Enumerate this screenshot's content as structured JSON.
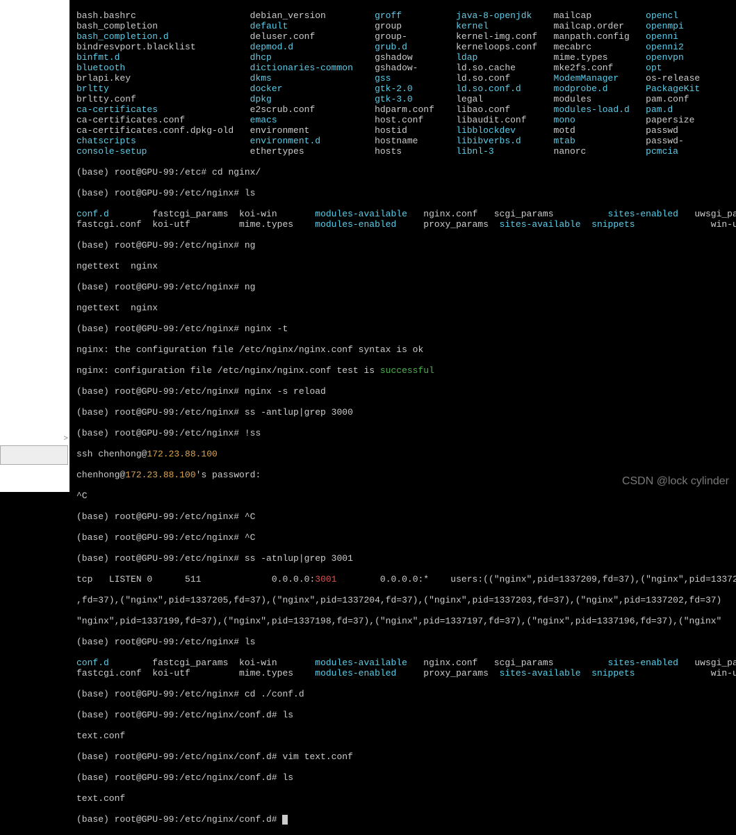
{
  "etc_ls": {
    "col1": [
      "bash.bashrc",
      "bash_completion",
      "bash_completion.d",
      "bindresvport.blacklist",
      "binfmt.d",
      "bluetooth",
      "brlapi.key",
      "brltty",
      "brltty.conf",
      "ca-certificates",
      "ca-certificates.conf",
      "ca-certificates.conf.dpkg-old",
      "chatscripts",
      "console-setup"
    ],
    "col1_class": [
      "w",
      "w",
      "c",
      "w",
      "c",
      "c",
      "w",
      "c",
      "w",
      "c",
      "w",
      "w",
      "c",
      "c"
    ],
    "col2": [
      "debian_version",
      "default",
      "deluser.conf",
      "depmod.d",
      "dhcp",
      "dictionaries-common",
      "dkms",
      "docker",
      "dpkg",
      "e2scrub.conf",
      "emacs",
      "environment",
      "environment.d",
      "ethertypes"
    ],
    "col2_class": [
      "w",
      "c",
      "w",
      "c",
      "c",
      "c",
      "c",
      "c",
      "c",
      "w",
      "c",
      "w",
      "c",
      "w"
    ],
    "col3": [
      "groff",
      "group",
      "group-",
      "grub.d",
      "gshadow",
      "gshadow-",
      "gss",
      "gtk-2.0",
      "gtk-3.0",
      "hdparm.conf",
      "host.conf",
      "hostid",
      "hostname",
      "hosts"
    ],
    "col3_class": [
      "c",
      "w",
      "w",
      "c",
      "w",
      "w",
      "c",
      "c",
      "c",
      "w",
      "w",
      "w",
      "w",
      "w"
    ],
    "col4": [
      "java-8-openjdk",
      "kernel",
      "kernel-img.conf",
      "kerneloops.conf",
      "ldap",
      "ld.so.cache",
      "ld.so.conf",
      "ld.so.conf.d",
      "legal",
      "libao.conf",
      "libaudit.conf",
      "libblockdev",
      "libibverbs.d",
      "libnl-3"
    ],
    "col4_class": [
      "c",
      "c",
      "w",
      "w",
      "c",
      "w",
      "w",
      "c",
      "w",
      "w",
      "w",
      "c",
      "c",
      "c"
    ],
    "col5": [
      "mailcap",
      "mailcap.order",
      "manpath.config",
      "mecabrc",
      "mime.types",
      "mke2fs.conf",
      "ModemManager",
      "modprobe.d",
      "modules",
      "modules-load.d",
      "mono",
      "motd",
      "mtab",
      "nanorc"
    ],
    "col5_class": [
      "w",
      "w",
      "w",
      "w",
      "w",
      "w",
      "c",
      "c",
      "w",
      "c",
      "c",
      "w",
      "c",
      "w"
    ],
    "col6": [
      "opencl",
      "openmpi",
      "openni",
      "openni2",
      "openvpn",
      "opt",
      "os-release",
      "PackageKit",
      "pam.conf",
      "pam.d",
      "papersize",
      "passwd",
      "passwd-",
      "pcmcia"
    ],
    "col6_class": [
      "c",
      "c",
      "c",
      "c",
      "c",
      "c",
      "w",
      "c",
      "w",
      "c",
      "w",
      "w",
      "w",
      "c"
    ]
  },
  "prompt_etc": "(base) root@GPU-99:/etc# ",
  "prompt_nginx": "(base) root@GPU-99:/etc/nginx# ",
  "prompt_confd": "(base) root@GPU-99:/etc/nginx/conf.d# ",
  "cmds": {
    "cd_nginx": "cd nginx/",
    "ls": "ls",
    "ng": "ng",
    "ngettext_nginx": "ngettext  nginx",
    "nginx_t": "nginx -t",
    "t_line1": "nginx: the configuration file /etc/nginx/nginx.conf syntax is ok",
    "t_line2_a": "nginx: configuration file /etc/nginx/nginx.conf test is ",
    "t_line2_b": "successful",
    "reload": "nginx -s reload",
    "ss1": "ss -antlup|grep 3000",
    "bang_ss": "!ss",
    "ssh_a": "ssh chenhong@",
    "ssh_ip": "172.23.88.100",
    "pw_a": "chenhong@",
    "pw_b": "172.23.88.100",
    "pw_c": "'s password:",
    "ctrlc": "^C",
    "ss2": "ss -atnlup|grep 3001",
    "tcp_a": "tcp   LISTEN 0      511             0.0.0.0:",
    "tcp_port": "3001",
    "tcp_b": "        0.0.0.0:*    users:((\"nginx\",pid=1337209,fd=37),(\"nginx\",pid=13372",
    "tcp_l2": ",fd=37),(\"nginx\",pid=1337205,fd=37),(\"nginx\",pid=1337204,fd=37),(\"nginx\",pid=1337203,fd=37),(\"nginx\",pid=1337202,fd=37)",
    "tcp_l3": "\"nginx\",pid=1337199,fd=37),(\"nginx\",pid=1337198,fd=37),(\"nginx\",pid=1337197,fd=37),(\"nginx\",pid=1337196,fd=37),(\"nginx\"",
    "cd_confd": "cd ./conf.d",
    "textconf": "text.conf",
    "vim": "vim text.conf"
  },
  "nginx_ls": {
    "row1": {
      "c1": "conf.d",
      "c1_cls": "c",
      "c2": "fastcgi_params  koi-win",
      "c3": "modules-available",
      "c3_cls": "c",
      "c4": "nginx.conf   scgi_params",
      "c5": "sites-enabled",
      "c5_cls": "c",
      "c6": "uwsgi_params"
    },
    "row2": {
      "c1": "fastcgi.conf  koi-utf         mime.types  ",
      "c2": "modules-enabled",
      "c2_cls": "c",
      "c3": "proxy_params  ",
      "c4": "sites-available",
      "c4_cls": "c",
      "c5": "snippets",
      "c5_cls": "c",
      "c6": "win-utf"
    }
  },
  "watermark": "CSDN @lock cylinder"
}
